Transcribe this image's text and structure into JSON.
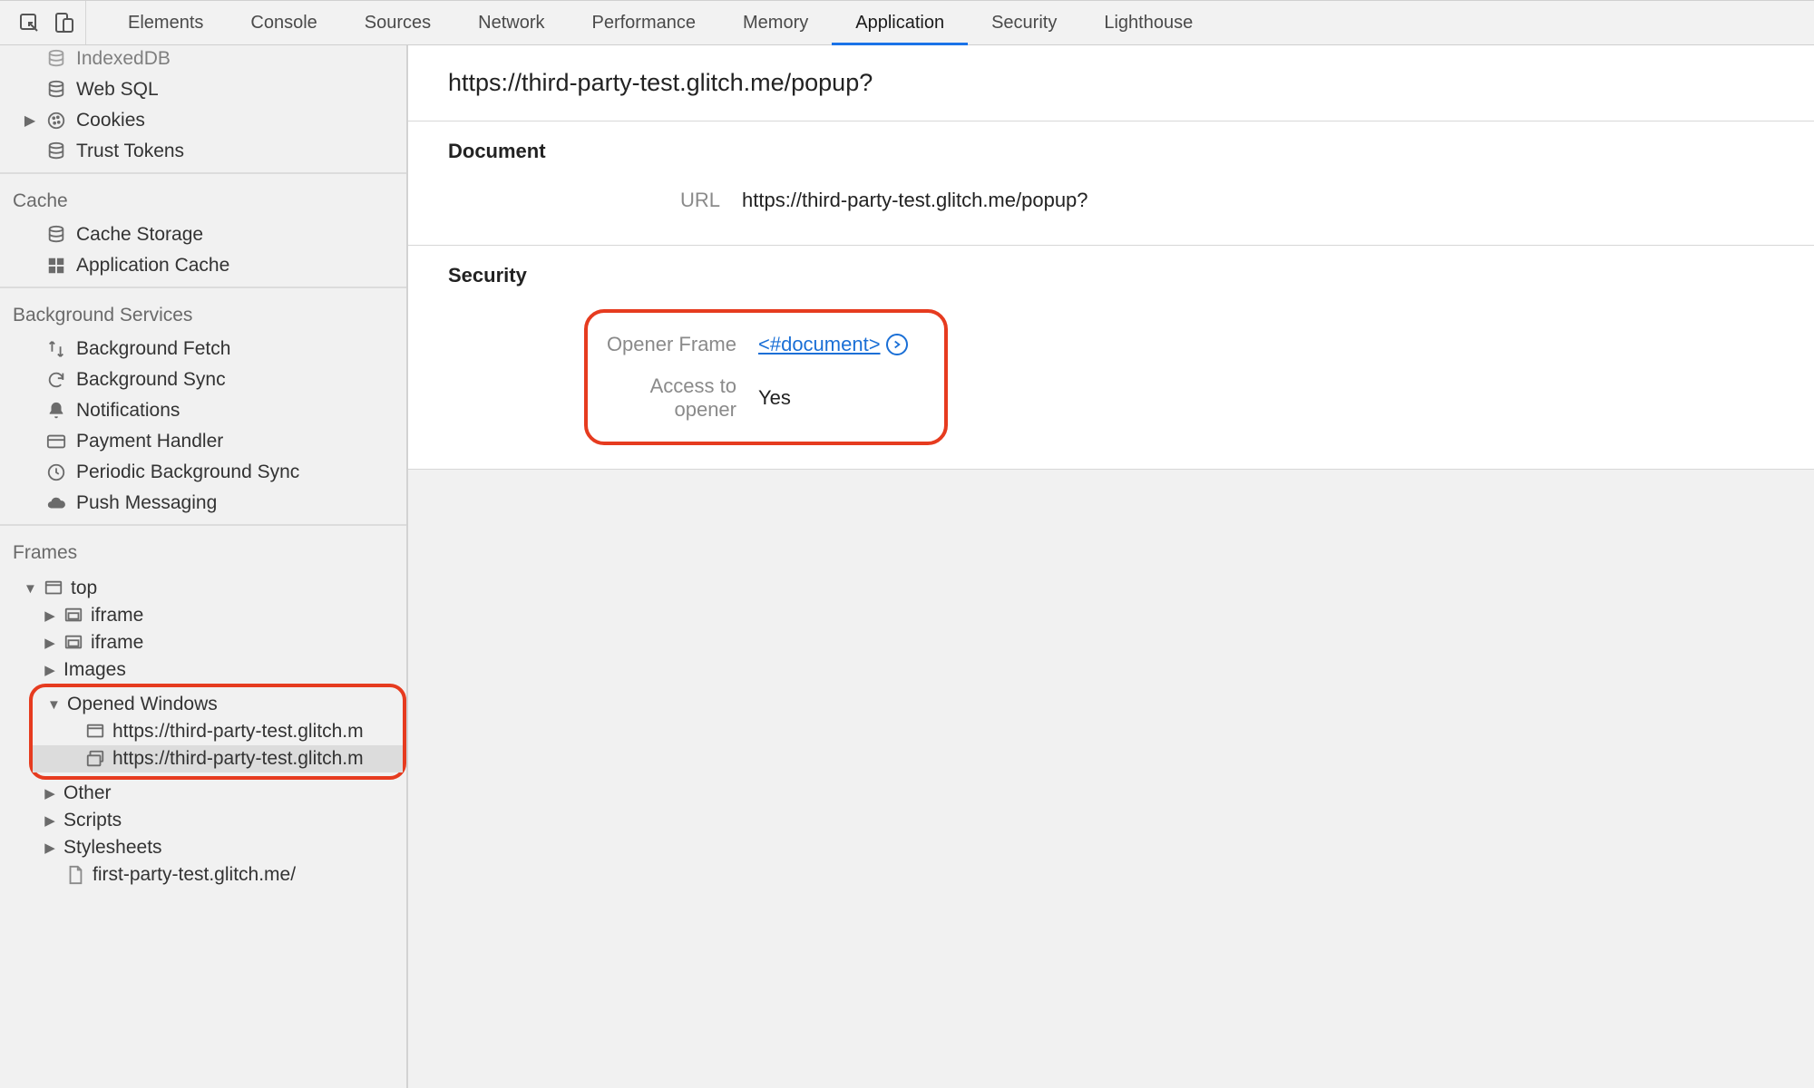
{
  "tabs": {
    "elements": "Elements",
    "console": "Console",
    "sources": "Sources",
    "network": "Network",
    "performance": "Performance",
    "memory": "Memory",
    "application": "Application",
    "security": "Security",
    "lighthouse": "Lighthouse"
  },
  "sidebar": {
    "storage": {
      "indexeddb": "IndexedDB",
      "websql": "Web SQL",
      "cookies": "Cookies",
      "trust_tokens": "Trust Tokens"
    },
    "cache": {
      "title": "Cache",
      "cache_storage": "Cache Storage",
      "application_cache": "Application Cache"
    },
    "bg_services": {
      "title": "Background Services",
      "background_fetch": "Background Fetch",
      "background_sync": "Background Sync",
      "notifications": "Notifications",
      "payment_handler": "Payment Handler",
      "periodic_sync": "Periodic Background Sync",
      "push_messaging": "Push Messaging"
    },
    "frames": {
      "title": "Frames",
      "top": "top",
      "iframe1": "iframe",
      "iframe2": "iframe",
      "images": "Images",
      "opened_windows": "Opened Windows",
      "ow1": "https://third-party-test.glitch.m",
      "ow2": "https://third-party-test.glitch.m",
      "other": "Other",
      "scripts": "Scripts",
      "stylesheets": "Stylesheets",
      "first_party": "first-party-test.glitch.me/"
    }
  },
  "main": {
    "title": "https://third-party-test.glitch.me/popup?",
    "document": {
      "heading": "Document",
      "url_label": "URL",
      "url_value": "https://third-party-test.glitch.me/popup?"
    },
    "security": {
      "heading": "Security",
      "opener_frame_label": "Opener Frame",
      "opener_frame_value": "<#document>",
      "access_label": "Access to opener",
      "access_value": "Yes"
    }
  }
}
